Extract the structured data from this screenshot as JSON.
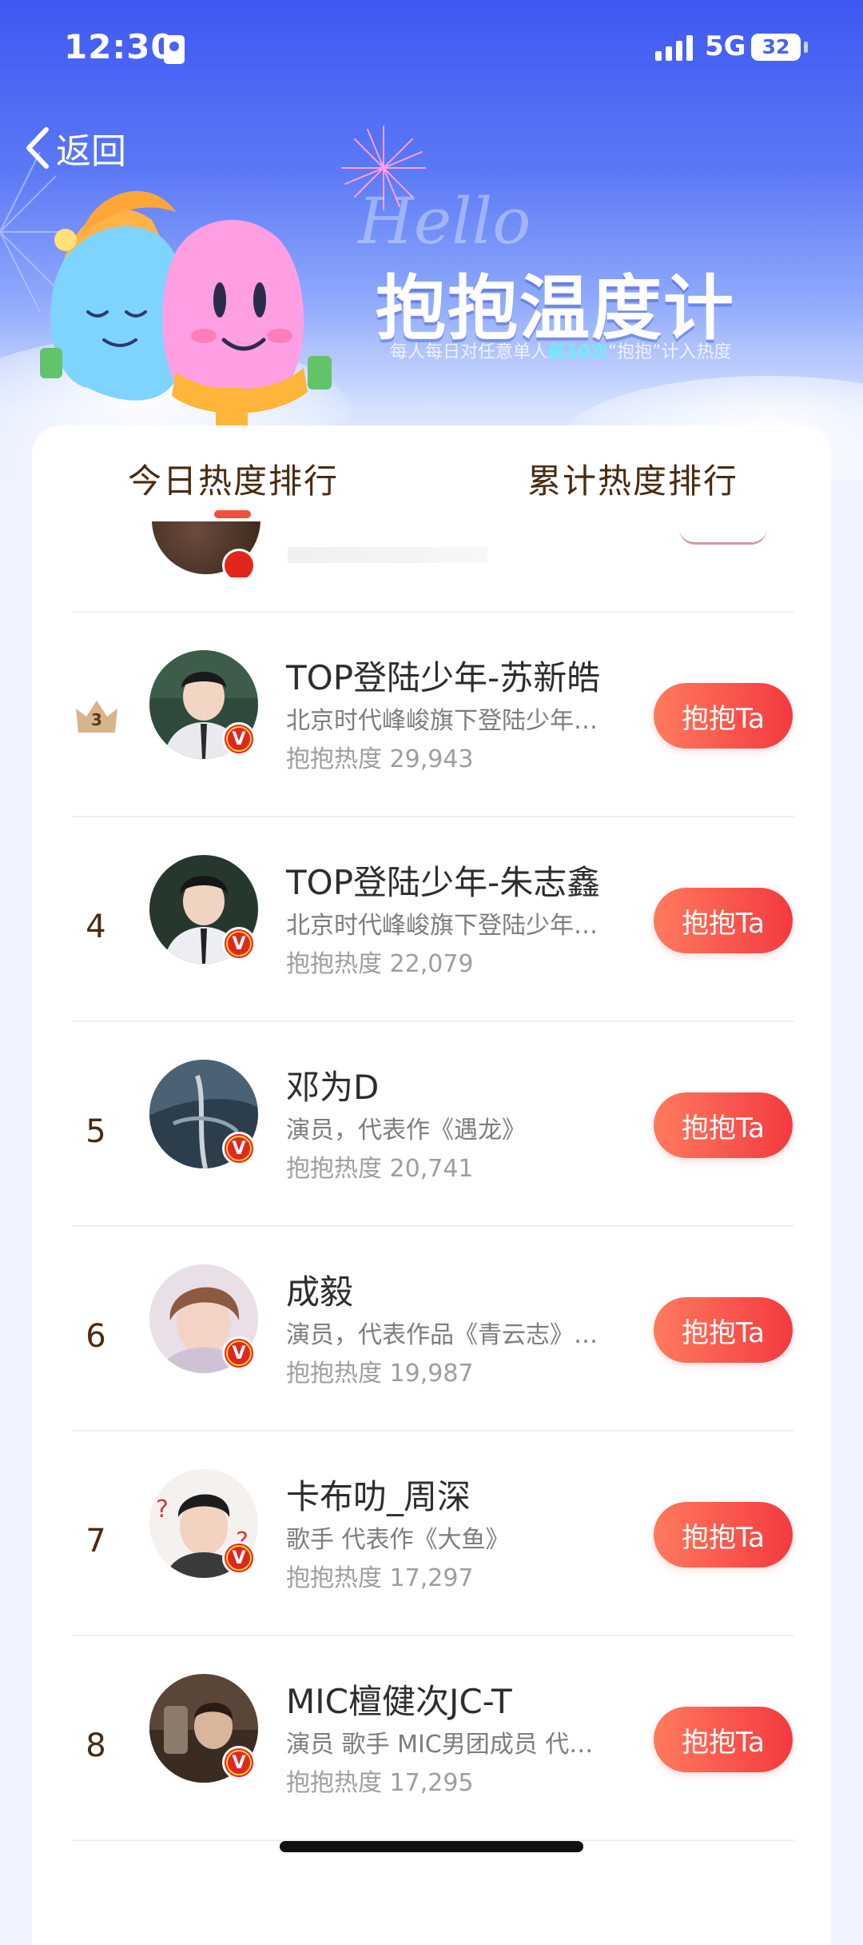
{
  "status_bar": {
    "time": "12:30",
    "network": "5G",
    "battery": "32"
  },
  "header": {
    "back_label": "返回",
    "hello_text": "Hello",
    "title": "抱抱温度计",
    "subtitle_pre": "每人每日对任意单人",
    "subtitle_highlight": "前10次",
    "subtitle_post": "“抱抱”计入热度",
    "accent_color": "#66f0ff"
  },
  "tabs": [
    {
      "label": "今日热度排行",
      "active": true
    },
    {
      "label": "累计热度排行",
      "active": false
    }
  ],
  "ranking": [
    {
      "rank": "3",
      "name": "TOP登陆少年-苏新皓",
      "desc": "北京时代峰峻旗下登陆少年…",
      "heat": "抱抱热度 29,943",
      "button": "抱抱Ta",
      "crown": true
    },
    {
      "rank": "4",
      "name": "TOP登陆少年-朱志鑫",
      "desc": "北京时代峰峻旗下登陆少年…",
      "heat": "抱抱热度 22,079",
      "button": "抱抱Ta"
    },
    {
      "rank": "5",
      "name": "邓为D",
      "desc": "演员，代表作《遇龙》",
      "heat": "抱抱热度 20,741",
      "button": "抱抱Ta"
    },
    {
      "rank": "6",
      "name": "成毅",
      "desc": "演员，代表作品《青云志》…",
      "heat": "抱抱热度 19,987",
      "button": "抱抱Ta"
    },
    {
      "rank": "7",
      "name": "卡布叻_周深",
      "desc": "歌手 代表作《大鱼》",
      "heat": "抱抱热度 17,297",
      "button": "抱抱Ta"
    },
    {
      "rank": "8",
      "name": "MIC檀健次JC-T",
      "desc": "演员 歌手 MIC男团成员 代…",
      "heat": "抱抱热度 17,295",
      "button": "抱抱Ta"
    }
  ],
  "verified_mark": "V",
  "colors": {
    "button_gradient_start": "#ff7a5e",
    "button_gradient_end": "#f33a3f",
    "tab_indicator": "#f0503e",
    "header_blue": "#3e58f2"
  }
}
